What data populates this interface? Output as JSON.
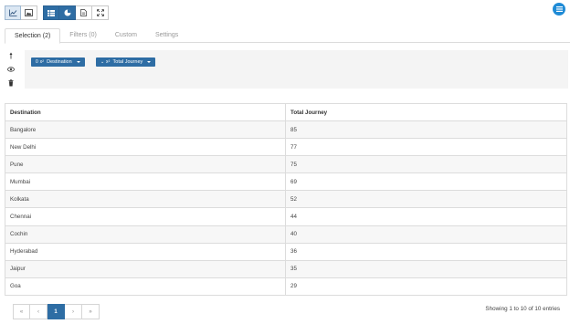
{
  "toolbar": {
    "left_group": [
      {
        "icon": "line-chart-icon",
        "active": true
      },
      {
        "icon": "image-icon",
        "active": false
      }
    ],
    "right_group": [
      {
        "icon": "table-icon",
        "active": true
      },
      {
        "icon": "pie-chart-icon",
        "active": false
      },
      {
        "icon": "document-icon",
        "active": false
      },
      {
        "icon": "expand-icon",
        "active": false
      }
    ],
    "menu_icon": "hamburger-menu-icon"
  },
  "tabs": [
    {
      "label": "Selection (2)",
      "active": true
    },
    {
      "label": "Filters (0)",
      "active": false
    },
    {
      "label": "Custom",
      "active": false
    },
    {
      "label": "Settings",
      "active": false
    }
  ],
  "side_icons": [
    "pin-icon",
    "eye-icon",
    "trash-icon"
  ],
  "chips": [
    {
      "prefix": "0 x²",
      "label": "Destination"
    },
    {
      "prefix": "⌄ x²",
      "label": "Total Journey"
    }
  ],
  "table": {
    "headers": [
      "Destination",
      "Total Journey"
    ],
    "rows": [
      [
        "Bangalore",
        "85"
      ],
      [
        "New Delhi",
        "77"
      ],
      [
        "Pune",
        "75"
      ],
      [
        "Mumbai",
        "69"
      ],
      [
        "Kolkata",
        "52"
      ],
      [
        "Chennai",
        "44"
      ],
      [
        "Cochin",
        "40"
      ],
      [
        "Hyderabad",
        "36"
      ],
      [
        "Jaipur",
        "35"
      ],
      [
        "Goa",
        "29"
      ]
    ]
  },
  "pagination": {
    "first": "«",
    "prev": "‹",
    "current": "1",
    "next": "›",
    "last": "»"
  },
  "status": {
    "showing": "Showing 1 to 10 of 10 entries"
  },
  "colors": {
    "accent": "#2e6da4",
    "fab": "#1f8bd6"
  }
}
